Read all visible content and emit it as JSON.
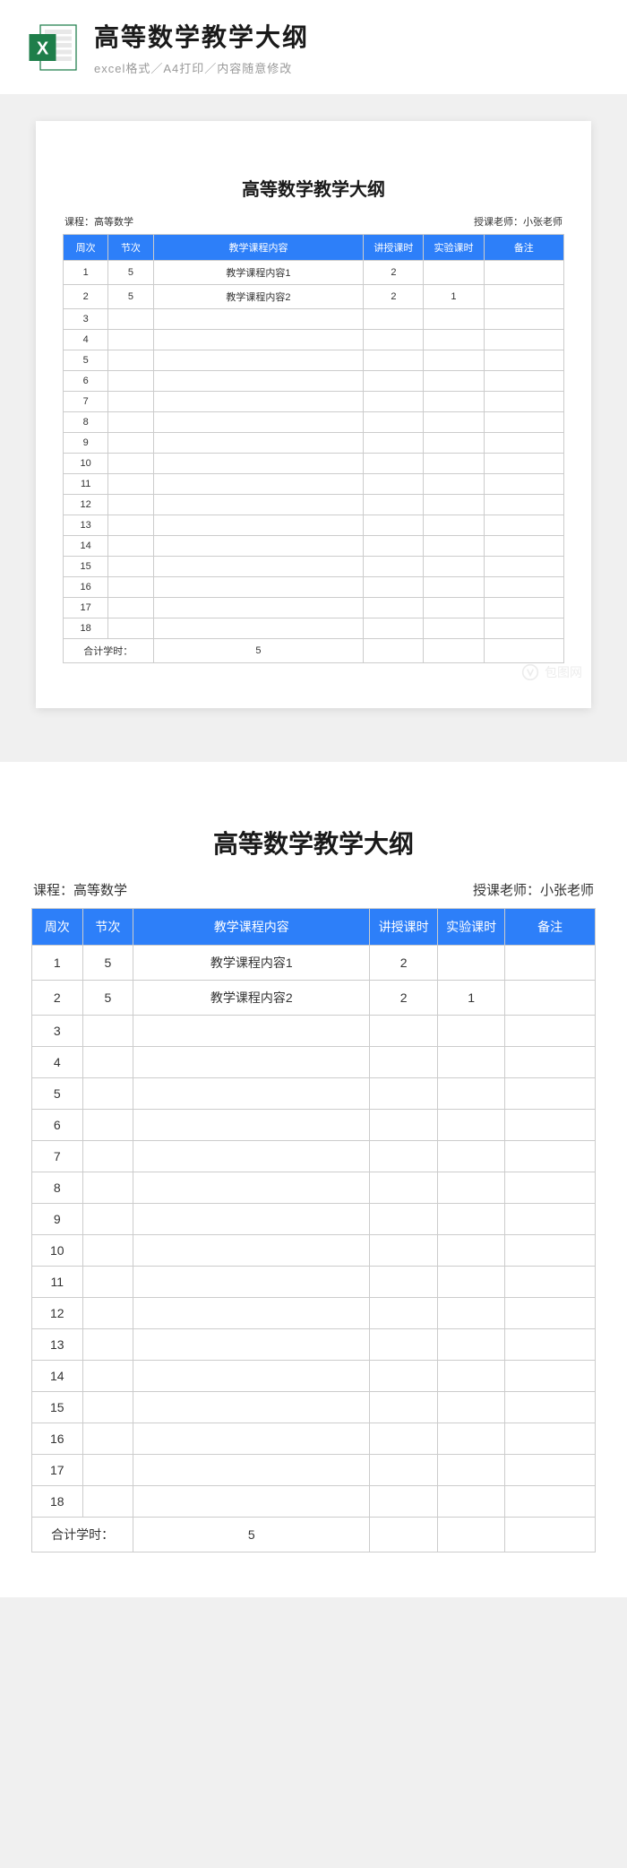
{
  "banner": {
    "title": "高等数学教学大纲",
    "subtitle": "excel格式／A4打印／内容随意修改"
  },
  "document": {
    "title": "高等数学教学大纲",
    "course_label": "课程：",
    "course_name": "高等数学",
    "teacher_label": "授课老师：",
    "teacher_name": "小张老师"
  },
  "table": {
    "headers": {
      "week": "周次",
      "session": "节次",
      "content": "教学课程内容",
      "lecture": "讲授课时",
      "lab": "实验课时",
      "note": "备注"
    },
    "rows": [
      {
        "week": "1",
        "session": "5",
        "content": "教学课程内容1",
        "lecture": "2",
        "lab": "",
        "note": ""
      },
      {
        "week": "2",
        "session": "5",
        "content": "教学课程内容2",
        "lecture": "2",
        "lab": "1",
        "note": ""
      },
      {
        "week": "3",
        "session": "",
        "content": "",
        "lecture": "",
        "lab": "",
        "note": ""
      },
      {
        "week": "4",
        "session": "",
        "content": "",
        "lecture": "",
        "lab": "",
        "note": ""
      },
      {
        "week": "5",
        "session": "",
        "content": "",
        "lecture": "",
        "lab": "",
        "note": ""
      },
      {
        "week": "6",
        "session": "",
        "content": "",
        "lecture": "",
        "lab": "",
        "note": ""
      },
      {
        "week": "7",
        "session": "",
        "content": "",
        "lecture": "",
        "lab": "",
        "note": ""
      },
      {
        "week": "8",
        "session": "",
        "content": "",
        "lecture": "",
        "lab": "",
        "note": ""
      },
      {
        "week": "9",
        "session": "",
        "content": "",
        "lecture": "",
        "lab": "",
        "note": ""
      },
      {
        "week": "10",
        "session": "",
        "content": "",
        "lecture": "",
        "lab": "",
        "note": ""
      },
      {
        "week": "11",
        "session": "",
        "content": "",
        "lecture": "",
        "lab": "",
        "note": ""
      },
      {
        "week": "12",
        "session": "",
        "content": "",
        "lecture": "",
        "lab": "",
        "note": ""
      },
      {
        "week": "13",
        "session": "",
        "content": "",
        "lecture": "",
        "lab": "",
        "note": ""
      },
      {
        "week": "14",
        "session": "",
        "content": "",
        "lecture": "",
        "lab": "",
        "note": ""
      },
      {
        "week": "15",
        "session": "",
        "content": "",
        "lecture": "",
        "lab": "",
        "note": ""
      },
      {
        "week": "16",
        "session": "",
        "content": "",
        "lecture": "",
        "lab": "",
        "note": ""
      },
      {
        "week": "17",
        "session": "",
        "content": "",
        "lecture": "",
        "lab": "",
        "note": ""
      },
      {
        "week": "18",
        "session": "",
        "content": "",
        "lecture": "",
        "lab": "",
        "note": ""
      }
    ],
    "footer": {
      "label": "合计学时：",
      "total": "5"
    }
  },
  "watermark": {
    "text": "包图网"
  }
}
